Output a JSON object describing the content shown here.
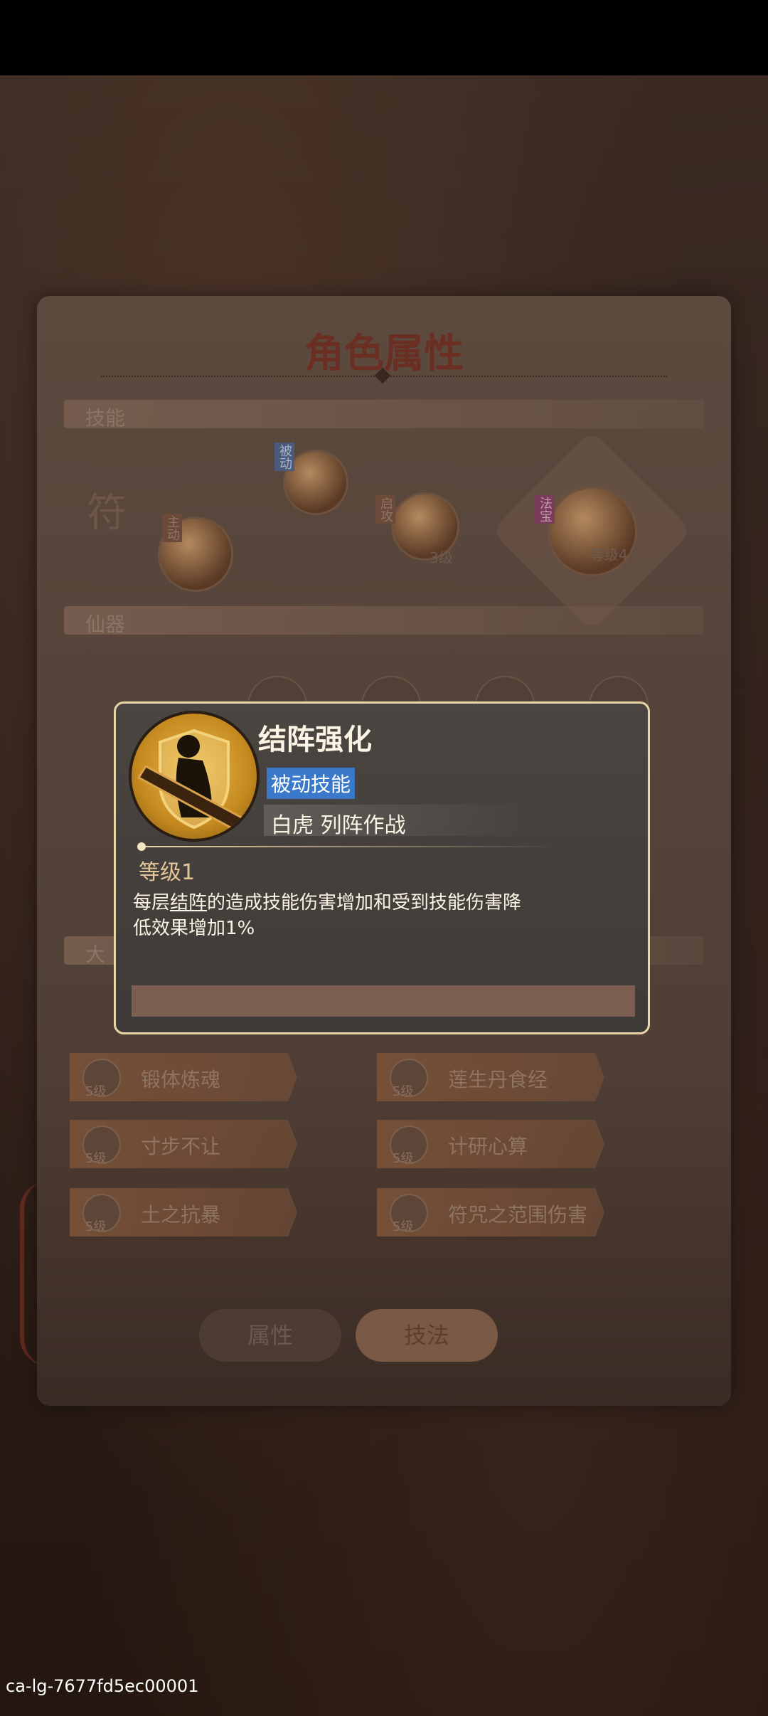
{
  "panel": {
    "title": "角色属性",
    "sections": {
      "skills": "技能",
      "xianqi": "仙器",
      "talent": "大"
    },
    "skill_row": {
      "fu_label": "符",
      "zhudong_tag": "主动",
      "beidong_tag": "被动",
      "jidong_tag": "启攻",
      "fabao_tag": "法宝",
      "lvl_3": "3级",
      "lvl_zhuan": "等级4"
    },
    "talents": [
      {
        "label": "锻体炼魂",
        "level": "5级"
      },
      {
        "label": "莲生丹食经",
        "level": "5级"
      },
      {
        "label": "寸步不让",
        "level": "5级"
      },
      {
        "label": "计研心算",
        "level": "5级"
      },
      {
        "label": "土之抗暴",
        "level": "5级"
      },
      {
        "label": "符咒之范围伤害",
        "level": "5级"
      }
    ],
    "tabs": {
      "attr": "属性",
      "skill": "技法"
    }
  },
  "popup": {
    "name": "结阵强化",
    "type": "被动技能",
    "group": "白虎 列阵作战",
    "level": "等级1",
    "desc_prefix": "每层",
    "desc_keyword": "结阵",
    "desc_suffix": "的造成技能伤害增加和受到技能伤害降低效果增加1%",
    "icon": "warrior-silhouette-icon"
  },
  "watermark": "ca-lg-7677fd5ec00001",
  "colors": {
    "popup_border": "#e9d7a8",
    "type_badge": "#3a78c9",
    "level_text": "#e6c79a"
  }
}
